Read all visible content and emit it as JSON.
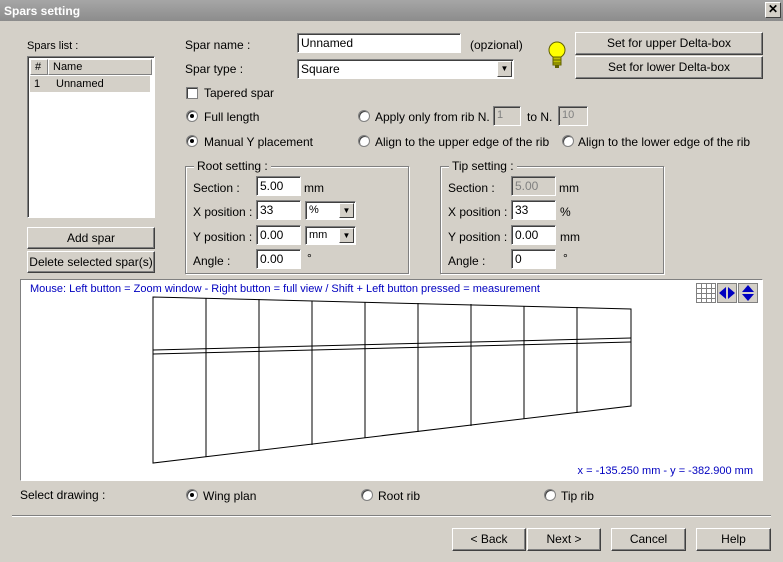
{
  "window": {
    "title": "Spars setting"
  },
  "spars_list": {
    "label": "Spars list :",
    "col_num": "#",
    "col_name": "Name",
    "rows": [
      {
        "num": "1",
        "name": "Unnamed"
      }
    ],
    "add_button": "Add spar",
    "delete_button": "Delete selected spar(s)"
  },
  "spar": {
    "name_label": "Spar name :",
    "name_value": "Unnamed",
    "optional": "(opzional)",
    "type_label": "Spar type :",
    "type_value": "Square",
    "tapered_label": "Tapered spar",
    "full_length_label": "Full length",
    "apply_only_label": "Apply only from rib N.",
    "from_rib": "1",
    "to_label": "to N.",
    "to_rib": "10",
    "manual_y_label": "Manual Y placement",
    "align_upper_label": "Align to the upper edge of the rib",
    "align_lower_label": "Align to the lower edge of the rib"
  },
  "delta_box": {
    "upper_button": "Set for upper Delta-box",
    "lower_button": "Set for lower Delta-box"
  },
  "root": {
    "title": "Root setting :",
    "section_label": "Section :",
    "section_value": "5.00",
    "section_unit": "mm",
    "x_label": "X position :",
    "x_value": "33",
    "x_unit": "%",
    "y_label": "Y position :",
    "y_value": "0.00",
    "y_unit": "mm",
    "angle_label": "Angle :",
    "angle_value": "0.00",
    "angle_unit": "°"
  },
  "tip": {
    "title": "Tip setting  :",
    "section_label": "Section :",
    "section_value": "5.00",
    "section_unit": "mm",
    "x_label": "X position :",
    "x_value": "33",
    "x_unit": "%",
    "y_label": "Y position :",
    "y_value": "0.00",
    "y_unit": "mm",
    "angle_label": "Angle :",
    "angle_value": "0",
    "angle_unit": "°"
  },
  "drawing": {
    "hint": "Mouse: Left button = Zoom window - Right button = full view / Shift + Left button pressed = measurement",
    "coords": "x = -135.250 mm - y = -382.900 mm",
    "hint_color": "#0000c0"
  },
  "select_drawing": {
    "label": "Select drawing :",
    "wing_plan": "Wing plan",
    "root_rib": "Root rib",
    "tip_rib": "Tip rib"
  },
  "footer": {
    "back": "< Back",
    "next": "Next >",
    "cancel": "Cancel",
    "help": "Help"
  }
}
